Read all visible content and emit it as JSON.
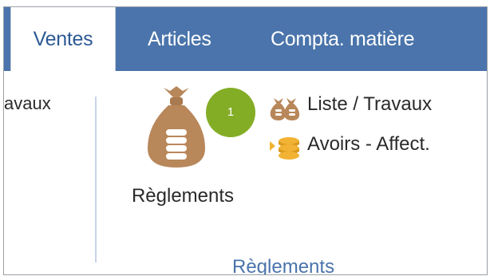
{
  "tabs": [
    {
      "label": "Ventes",
      "active": true
    },
    {
      "label": "Articles",
      "active": false
    },
    {
      "label": "Compta. matière",
      "active": false
    }
  ],
  "ribbon": {
    "cut_label": "avaux",
    "big_button": {
      "label": "Règlements",
      "icon": "money-bag-coins-icon"
    },
    "badge": "1",
    "small_buttons": [
      {
        "label": "Liste / Travaux",
        "icon": "money-bags-icon"
      },
      {
        "label": "Avoirs - Affect.",
        "icon": "coins-arrow-icon"
      }
    ],
    "group_label": "Règlements"
  },
  "colors": {
    "tab_bar": "#4a74ab",
    "active_tab_text": "#2d5a93",
    "badge": "#84ad26",
    "icon_brown": "#b8875a",
    "coin_gold": "#f2b233",
    "group_label": "#4a74ab"
  }
}
